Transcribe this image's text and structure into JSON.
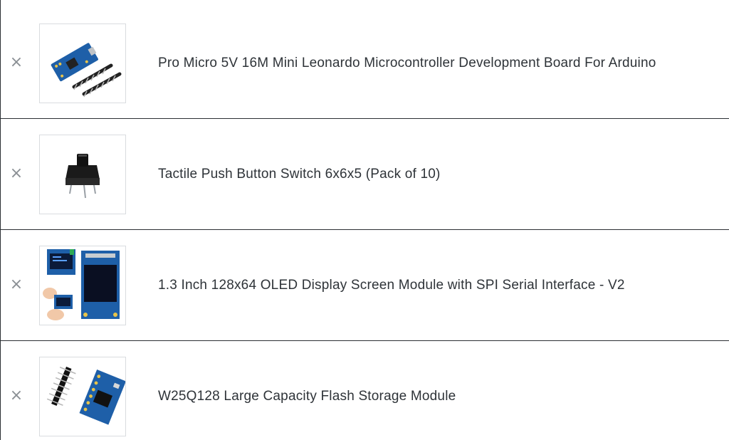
{
  "cart": {
    "remove_symbol": "×",
    "items": [
      {
        "title": "Pro Micro 5V 16M Mini Leonardo Microcontroller Development Board For Arduino",
        "image_icon": "pro-micro-board-icon"
      },
      {
        "title": "Tactile Push Button Switch 6x6x5 (Pack of 10)",
        "image_icon": "tactile-button-icon"
      },
      {
        "title": "1.3 Inch 128x64 OLED Display Screen Module with SPI Serial Interface - V2",
        "image_icon": "oled-display-icon"
      },
      {
        "title": "W25Q128 Large Capacity Flash Storage Module",
        "image_icon": "flash-module-icon"
      }
    ]
  },
  "colors": {
    "divider": "#2b2f33",
    "text": "#2e3338",
    "remove_icon": "#8a8f94",
    "pcb_blue": "#1e5fa8"
  }
}
